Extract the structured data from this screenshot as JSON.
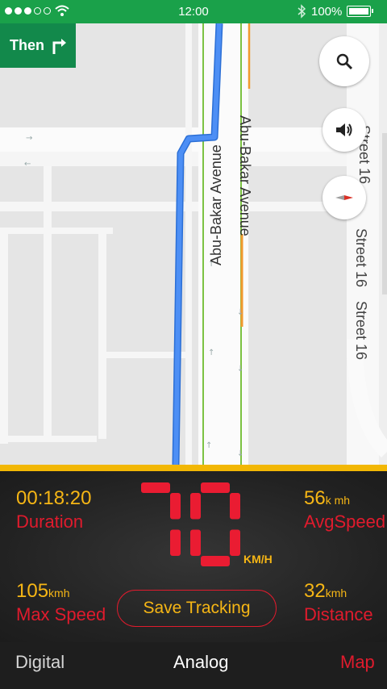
{
  "status_bar": {
    "time": "12:00",
    "battery": "100%"
  },
  "nav": {
    "then_label": "Then"
  },
  "map": {
    "street_main_left": "Abu-Bakar Avenue",
    "street_main_right": "Abu-Bakar Avenue",
    "street_side_a": "Street 16",
    "street_side_b": "Street 16",
    "street_side_c": "Street 16",
    "route_color": "#4285f4",
    "lane_green": "#7cc242",
    "lane_orange": "#f29a2e"
  },
  "dashboard": {
    "duration_value": "00:18:20",
    "duration_label": "Duration",
    "avg_value": "56",
    "avg_unit": "k mh",
    "avg_label": "AvgSpeed",
    "max_value": "105",
    "max_unit": "kmh",
    "max_label": "Max Speed",
    "dist_value": "32",
    "dist_unit": "kmh",
    "dist_label": "Distance",
    "speed": "70",
    "speed_unit": "KM/H",
    "save_label": "Save Tracking",
    "colors": {
      "value": "#f6b615",
      "label": "#e01b2d",
      "accent": "#f2b705"
    }
  },
  "tabs": [
    {
      "label": "Digital"
    },
    {
      "label": "Analog"
    },
    {
      "label": "Map"
    }
  ]
}
